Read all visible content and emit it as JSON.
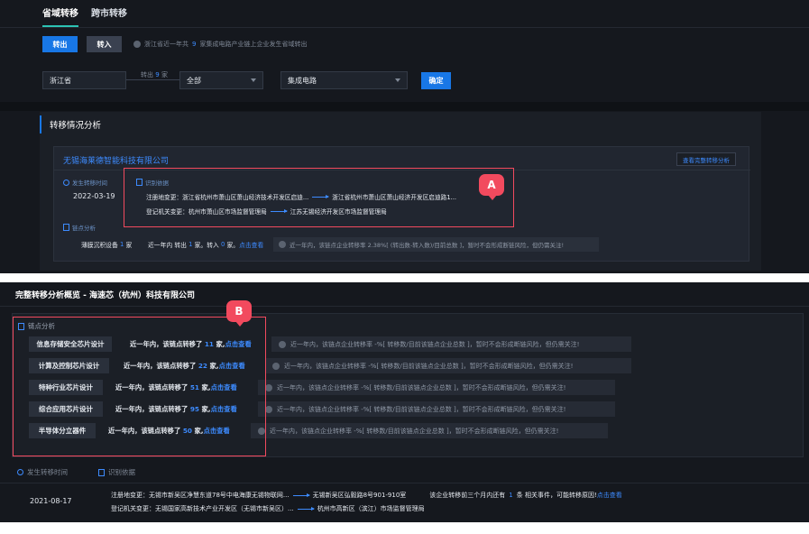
{
  "tabs": [
    "省域转移",
    "跨市转移"
  ],
  "direction_buttons": {
    "out": "转出",
    "in": "转入"
  },
  "info": {
    "prefix": "浙江省近一年共",
    "count": "9",
    "suffix": "家集成电路产业链上企业发生省域转出"
  },
  "filters": {
    "province": "浙江省",
    "connector_prefix": "转出",
    "connector_count": "9",
    "connector_suffix": "家",
    "scope": "全部",
    "chain": "集成电路",
    "confirm": "确定"
  },
  "analysis": {
    "title": "转移情况分析",
    "company": "无锡海莱德智能科技有限公司",
    "view_full": "查看完整转移分析",
    "time_label": "发生转移时间",
    "date": "2022-03-19",
    "basis_label": "识别依据",
    "reg_change": {
      "label": "注册地变更：",
      "from": "浙江省杭州市萧山区萧山经济技术开发区启迪...",
      "to": "浙江省杭州市萧山区萧山经济开发区启迪路1..."
    },
    "org_change": {
      "label": "登记机关变更：",
      "from": "杭州市萧山区市场监督管理局",
      "to": "江苏无锡经济开发区市场监督管理局"
    },
    "node_label": "链点分析",
    "node": {
      "name_prefix": "薄膜沉积设备",
      "name_count": "1",
      "name_suffix": "家",
      "stats_prefix": "近一年内 转出",
      "out_count": "1",
      "stats_mid": "家。转入",
      "in_count": "0",
      "stats_suffix": "家。",
      "link": "点击查看"
    },
    "notice": "近一年内，该链点企业转移率 2.38%[ (转出数-转入数)/目前总数 ]，暂时不会形成断链风险，但仍需关注!"
  },
  "annotations": {
    "a": "A",
    "b": "B"
  },
  "overview": {
    "title": "完整转移分析概览 - 海速芯（杭州）科技有限公司",
    "node_label": "链点分析",
    "rows": [
      {
        "name": "信息存储安全芯片设计",
        "prefix": "近一年内，该链点转移了",
        "count": "11",
        "suffix": "家,",
        "link": "点击查看",
        "notice": "近一年内，该链点企业转移率 -%[ 转移数/目前该链点企业总数 ]，暂时不会形成断链风险，但仍需关注!"
      },
      {
        "name": "计算及控制芯片设计",
        "prefix": "近一年内，该链点转移了",
        "count": "22",
        "suffix": "家,",
        "link": "点击查看",
        "notice": "近一年内，该链点企业转移率 -%[ 转移数/目前该链点企业总数 ]，暂时不会形成断链风险，但仍需关注!"
      },
      {
        "name": "特种行业芯片设计",
        "prefix": "近一年内，该链点转移了",
        "count": "51",
        "suffix": "家,",
        "link": "点击查看",
        "notice": "近一年内，该链点企业转移率 -%[ 转移数/目前该链点企业总数 ]，暂时不会形成断链风险，但仍需关注!"
      },
      {
        "name": "综合应用芯片设计",
        "prefix": "近一年内，该链点转移了",
        "count": "95",
        "suffix": "家,",
        "link": "点击查看",
        "notice": "近一年内，该链点企业转移率 -%[ 转移数/目前该链点企业总数 ]，暂时不会形成断链风险，但仍需关注!"
      },
      {
        "name": "半导体分立器件",
        "prefix": "近一年内，该链点转移了",
        "count": "50",
        "suffix": "家,",
        "link": "点击查看",
        "notice": "近一年内，该链点企业转移率 -%[ 转移数/目前该链点企业总数 ]，暂时不会形成断链风险，但仍需关注!"
      }
    ],
    "time_label": "发生转移时间",
    "basis_label": "识别依据",
    "date": "2021-08-17",
    "reg_change": {
      "label": "注册地变更：",
      "from": "无锡市新吴区净慧东道78号中电海康无锡物联网...",
      "to": "无锡新吴区弘毅路8号901-910室"
    },
    "org_change": {
      "label": "登记机关变更：",
      "from": "无锡国家高新技术产业开发区（无锡市新吴区）...",
      "to": "杭州市高新区（滨江）市场监督管理局"
    },
    "event": {
      "prefix": "该企业转移前三个月内还有",
      "count": "1",
      "suffix": "条 相关事件，可能转移原因!",
      "link": "点击查看"
    }
  }
}
